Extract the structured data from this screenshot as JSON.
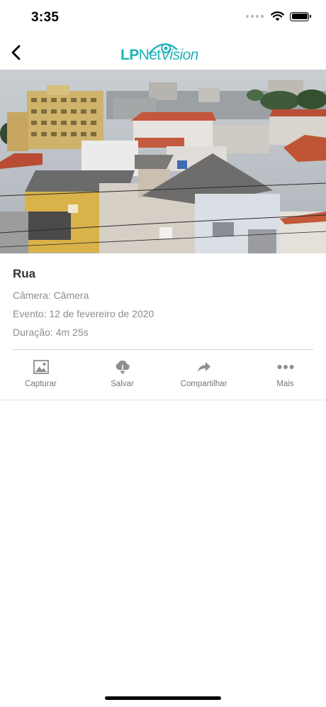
{
  "status_bar": {
    "time": "3:35"
  },
  "brand": {
    "lp": "LP",
    "net": "Net",
    "vision": "Vision",
    "color": "#1fb3b6"
  },
  "event": {
    "title": "Rua",
    "camera": "Câmera: Câmera",
    "date": "Evento: 12 de fevereiro de 2020",
    "duration": "Duração: 4m 25s"
  },
  "actions": [
    {
      "label": "Capturar",
      "icon": "image-icon"
    },
    {
      "label": "Salvar",
      "icon": "cloud-download-icon"
    },
    {
      "label": "Compartilhar",
      "icon": "share-icon"
    },
    {
      "label": "Mais",
      "icon": "more-icon"
    }
  ]
}
